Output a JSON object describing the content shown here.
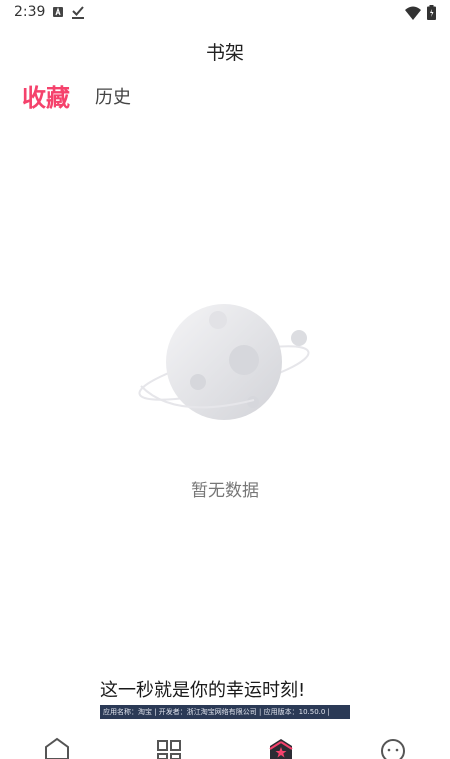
{
  "status_bar": {
    "time": "2:39",
    "icons": [
      "a-icon",
      "check-download-icon",
      "wifi-icon",
      "battery-icon"
    ]
  },
  "header": {
    "title": "书架"
  },
  "tabs": [
    {
      "label": "收藏",
      "active": true
    },
    {
      "label": "历史",
      "active": false
    }
  ],
  "empty_state": {
    "icon": "planet-illustration",
    "message": "暂无数据"
  },
  "ad": {
    "headline": "这一秒就是你的幸运时刻!",
    "info": "应用名称：淘宝 | 开发者：浙江淘宝网络有限公司 | 应用版本：10.50.0 |"
  },
  "bottom_nav": {
    "items": [
      "home-icon",
      "category-icon",
      "bookshelf-icon",
      "profile-icon"
    ],
    "active_color": "#f5426c"
  },
  "colors": {
    "accent": "#f5426c",
    "text_primary": "#222222",
    "text_muted": "#777777",
    "ad_strip": "#2b3a56"
  }
}
